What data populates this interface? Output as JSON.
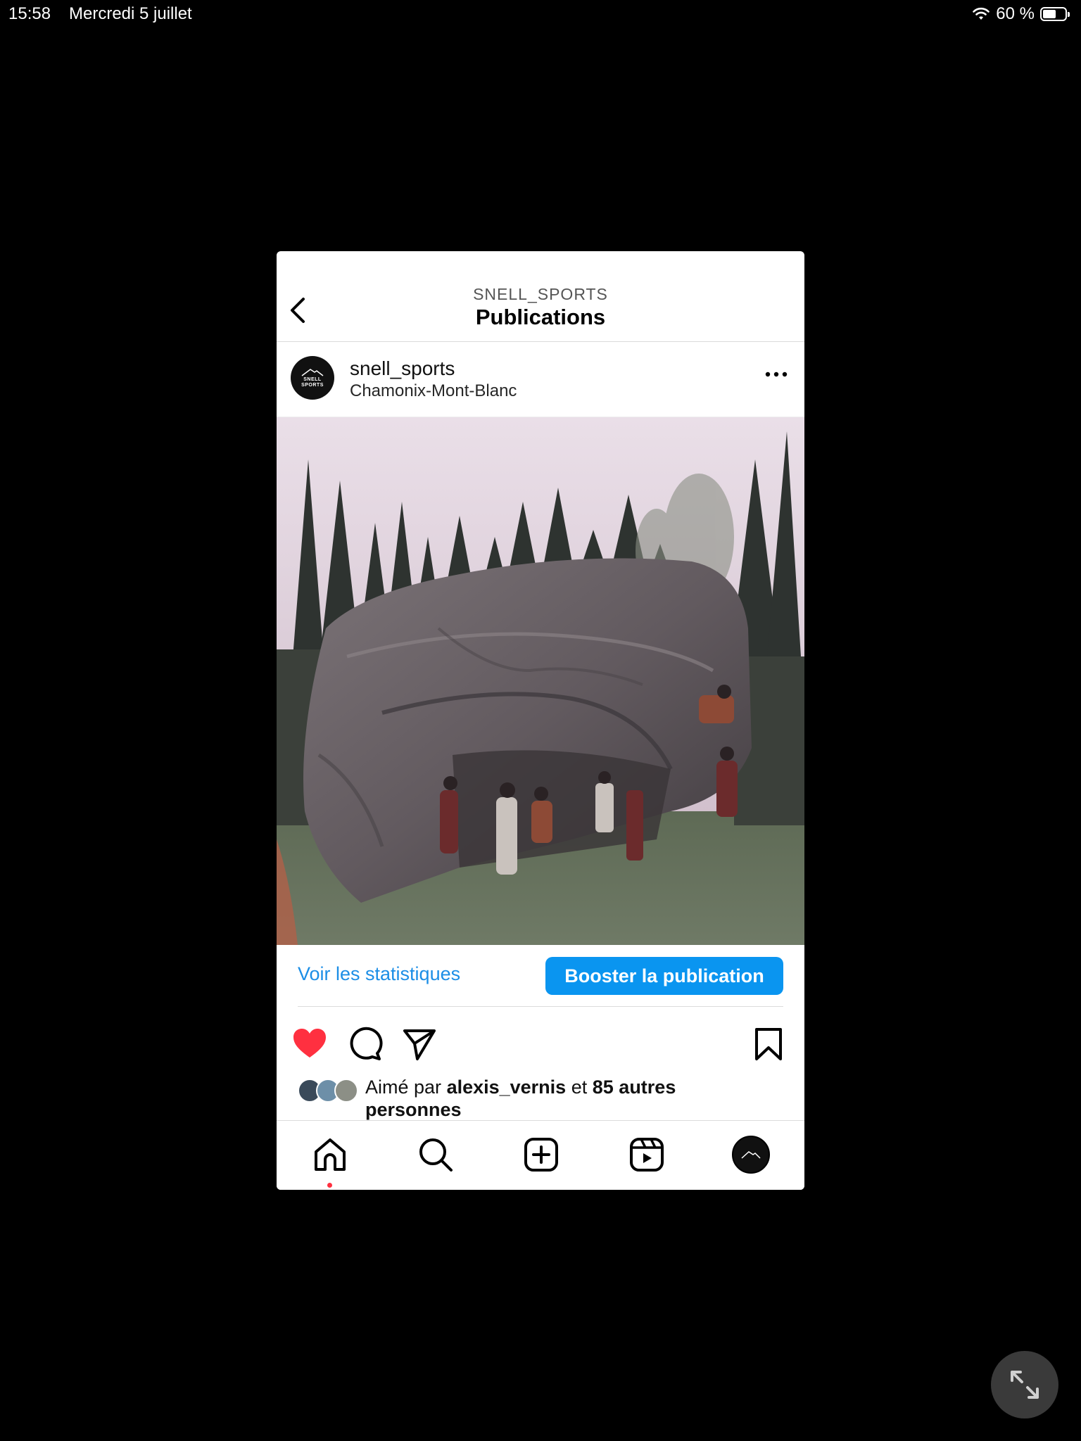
{
  "status_bar": {
    "time": "15:58",
    "date": "Mercredi 5 juillet",
    "battery_text": "60 %",
    "battery_level": 0.6
  },
  "header": {
    "subtitle": "SNELL_SPORTS",
    "title": "Publications"
  },
  "post": {
    "username": "snell_sports",
    "location": "Chamonix-Mont-Blanc",
    "avatar_logo_text": "SNELL SPORTS",
    "stats_link": "Voir les statistiques",
    "boost_button": "Booster la publication",
    "liked": true,
    "likes": {
      "prefix": "Aimé par",
      "user": "alexis_vernis",
      "connector": "et",
      "others": "85 autres personnes"
    }
  },
  "icons": {
    "back": "chevron-left-icon",
    "more": "more-horizontal-icon",
    "like": "heart-icon",
    "comment": "comment-icon",
    "share": "send-icon",
    "save": "bookmark-icon",
    "home": "home-icon",
    "search": "search-icon",
    "create": "plus-square-icon",
    "reels": "reels-icon",
    "profile": "profile-avatar",
    "fullscreen": "expand-icon"
  },
  "colors": {
    "accent_blue": "#0a95f0",
    "link_blue": "#1c8ee6",
    "like_red": "#ff3040",
    "notification_dot": "#ff3040"
  }
}
